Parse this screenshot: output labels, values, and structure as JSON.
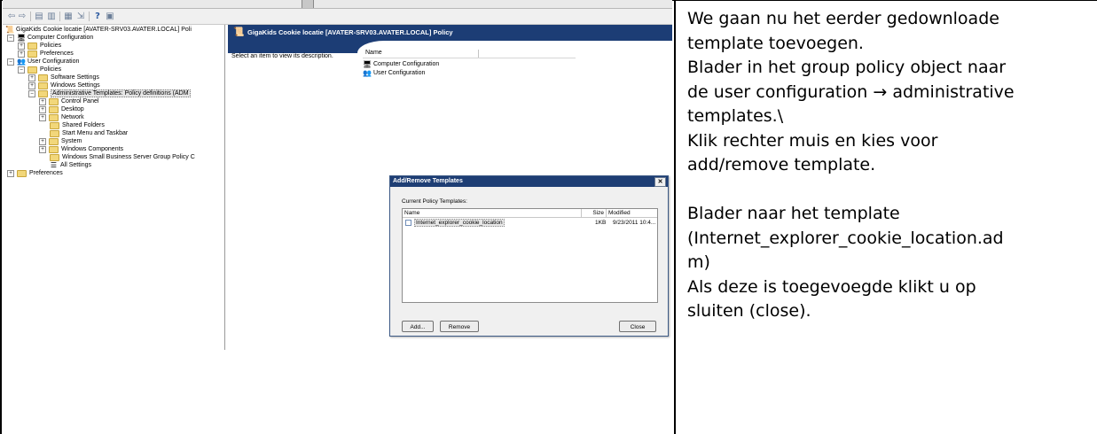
{
  "screenshot": {
    "tree": {
      "root": "GigaKids Cookie locatie [AVATER-SRV03.AVATER.LOCAL] Poli",
      "items": [
        {
          "label": "Computer Configuration"
        },
        {
          "label": "Policies"
        },
        {
          "label": "Preferences"
        },
        {
          "label": "User Configuration"
        },
        {
          "label": "Policies"
        },
        {
          "label": "Software Settings"
        },
        {
          "label": "Windows Settings"
        },
        {
          "label": "Administrative Templates: Policy definitions (ADM"
        },
        {
          "label": "Control Panel"
        },
        {
          "label": "Desktop"
        },
        {
          "label": "Network"
        },
        {
          "label": "Shared Folders"
        },
        {
          "label": "Start Menu and Taskbar"
        },
        {
          "label": "System"
        },
        {
          "label": "Windows Components"
        },
        {
          "label": "Windows Small Business Server Group Policy C"
        },
        {
          "label": "All Settings"
        },
        {
          "label": "Preferences"
        }
      ]
    },
    "right_panel": {
      "title": "GigaKids Cookie locatie [AVATER-SRV03.AVATER.LOCAL] Policy",
      "description": "Select an item to view its description.",
      "column_name": "Name",
      "rows": [
        "Computer Configuration",
        "User Configuration"
      ]
    },
    "dialog": {
      "title": "Add/Remove Templates",
      "close_glyph": "✕",
      "label": "Current Policy Templates:",
      "columns": {
        "name": "Name",
        "size": "Size",
        "modified": "Modified"
      },
      "row": {
        "name": "Internet_explorer_cookie_location",
        "size": "1KB",
        "modified": "9/23/2011 10:4..."
      },
      "buttons": {
        "add": "Add...",
        "remove": "Remove",
        "close": "Close"
      }
    }
  },
  "instructions": {
    "p1": [
      "We gaan nu het eerder gedownloade",
      "template toevoegen."
    ],
    "p2": [
      "Blader in het group policy object naar",
      "de user configuration",
      "→",
      "administrative",
      "templates.\\"
    ],
    "p3": [
      "Klik rechter muis en kies voor",
      "add/remove template."
    ],
    "p4": [
      "Blader naar het template",
      "(Internet_explorer_cookie_location.ad",
      "m)"
    ],
    "p5": [
      "Als deze is toegevoegde klikt u op",
      "sluiten (close)."
    ]
  },
  "colors": {
    "title_bar": "#1c3d75",
    "folder": "#f2d77a",
    "border": "#000000"
  }
}
